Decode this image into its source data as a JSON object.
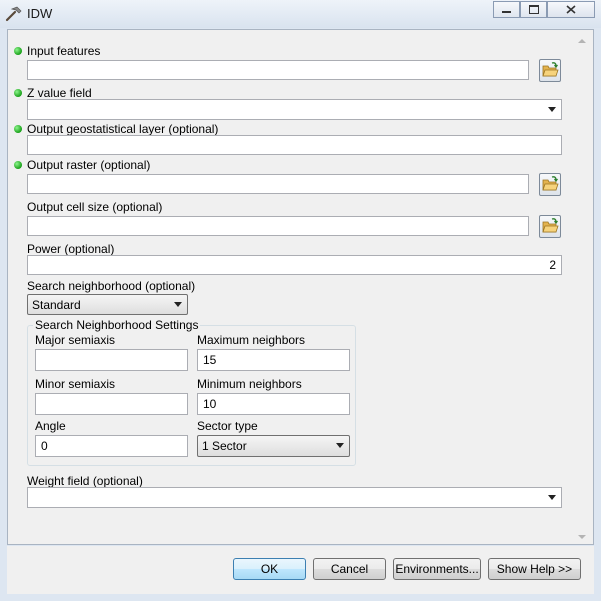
{
  "window": {
    "title": "IDW",
    "icon": "hammer-icon",
    "controls": {
      "minimize": "minimize-icon",
      "maximize": "maximize-icon",
      "close": "close-icon"
    }
  },
  "form": {
    "input_features": {
      "label": "Input features",
      "value": "",
      "required": true
    },
    "z_value_field": {
      "label": "Z value field",
      "value": "",
      "required": true
    },
    "output_geo_layer": {
      "label": "Output geostatistical layer (optional)",
      "value": "",
      "required": true
    },
    "output_raster": {
      "label": "Output raster (optional)",
      "value": "",
      "required": true
    },
    "output_cell_size": {
      "label": "Output cell size (optional)",
      "value": ""
    },
    "power": {
      "label": "Power (optional)",
      "value": "2"
    },
    "search_neighborhood": {
      "label": "Search neighborhood (optional)",
      "value": "Standard"
    },
    "neighborhood_settings": {
      "title": "Search Neighborhood Settings",
      "major_semiaxis": {
        "label": "Major semiaxis",
        "value": ""
      },
      "maximum_neighbors": {
        "label": "Maximum neighbors",
        "value": "15"
      },
      "minor_semiaxis": {
        "label": "Minor semiaxis",
        "value": ""
      },
      "minimum_neighbors": {
        "label": "Minimum neighbors",
        "value": "10"
      },
      "angle": {
        "label": "Angle",
        "value": "0"
      },
      "sector_type": {
        "label": "Sector type",
        "value": "1 Sector"
      }
    },
    "weight_field": {
      "label": "Weight field (optional)",
      "value": ""
    }
  },
  "buttons": {
    "ok": "OK",
    "cancel": "Cancel",
    "environments": "Environments...",
    "show_help": "Show Help >>"
  },
  "colors": {
    "required_dot": "#19a019",
    "accent": "#3c7fb1"
  }
}
